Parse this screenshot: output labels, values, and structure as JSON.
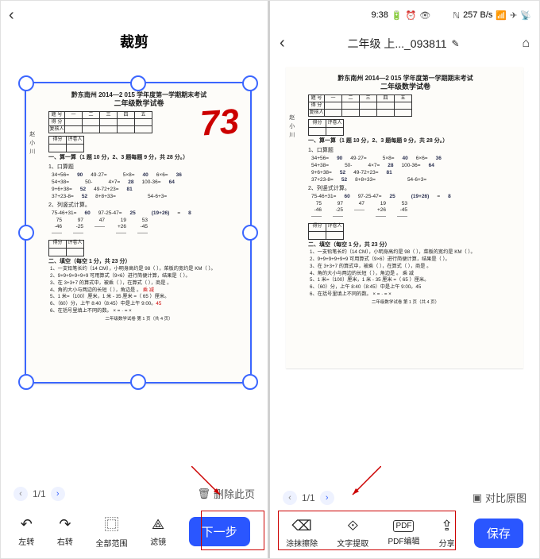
{
  "left": {
    "title": "裁剪",
    "back_glyph": "‹",
    "pager": "1/1",
    "delete_icon": "🗑",
    "delete_label": "删除此页",
    "toolbar": {
      "rotate_left": "左转",
      "rotate_right": "右转",
      "select_all": "全部范围",
      "filter": "滤镜",
      "next": "下一步"
    }
  },
  "right": {
    "status": {
      "time": "9:38",
      "batt": "🔋",
      "clock": "⏰",
      "eye": "👁",
      "nfc": "ℕ",
      "net": "257 B/s",
      "wifi": "📶",
      "plane": "✈",
      "sig": "📡"
    },
    "back_glyph": "‹",
    "doc_title": "二年级 上..._093811",
    "edit_icon": "✎",
    "home_icon": "⌂",
    "pager": "1/1",
    "compare_label": "对比原图",
    "toolbar": {
      "erase": "涂抹擦除",
      "ocr": "文字提取",
      "pdf": "PDF编辑",
      "share": "分享",
      "save": "保存"
    }
  },
  "exam": {
    "header": "黔东南州 2014—2 015 学年度第一学期期末考试",
    "subtitle": "二年级数学试卷",
    "score": "73",
    "row_labels": [
      "题 号",
      "得 分",
      "复核人"
    ],
    "col_labels": [
      "一",
      "二",
      "三",
      "四",
      "五"
    ],
    "score_labels": [
      "得分",
      "评卷人"
    ],
    "sec1_title": "一、算一算（1 题 10 分，2、3 题每题 9 分，共 28 分。）",
    "sub1": "1、口算题",
    "math1": [
      [
        "34+56=",
        "90",
        "49·27=",
        "",
        "5×8=",
        "40",
        "6×6=",
        "36"
      ],
      [
        "54+38=",
        "",
        "50-",
        "",
        "4×7=",
        "28",
        "100-36=",
        "64"
      ],
      [
        "9+6+38=",
        "52",
        "49-72+23=",
        "81",
        "",
        "",
        "",
        ""
      ],
      [
        "37+23-8=",
        "52",
        "8+8+33=",
        "",
        "",
        "",
        "54-6+3=",
        ""
      ]
    ],
    "sub2": "2、列竖式计算。",
    "math2": [
      [
        "75-46+31=",
        "60",
        "97-25-47=",
        "25",
        "",
        "(19+26)",
        "=",
        "8"
      ]
    ],
    "vstack": [
      [
        "75",
        "97",
        "",
        "19",
        "53"
      ],
      [
        "-46",
        "-25",
        "47",
        "+26",
        "-45"
      ],
      [
        "——",
        "——",
        "——",
        "——",
        "——"
      ]
    ],
    "sec2_title": "二、填空（每空 1 分，共 23 分）",
    "fills": [
      "1、一支铅笔长约（14 CM），小明身高约是 98（ ），菜板的宽约是 KM（ ）。",
      "2、9+9+9+9+9+9 可用算式（9×6）进行简便计算，结果是（ ）。",
      "3、在 3+3+7 的算式中，被乘（   ），在算式（   ），商是      。",
      "4、角的大小与两边的长短（         ），角边是      。  乘 减",
      "5、1 米=（100）厘米，1 米 - 35 厘米 =（ 65  ）厘米。",
      "6、（60）分，上午 8:40（8:45）中是上午 9:00。45",
      "6、在括号里填上不同的数。      ×   =   ·   =   ×"
    ],
    "footer": "二年级数学试卷  第 1 页（共 4 页）",
    "sidelabel": "赵小川"
  }
}
